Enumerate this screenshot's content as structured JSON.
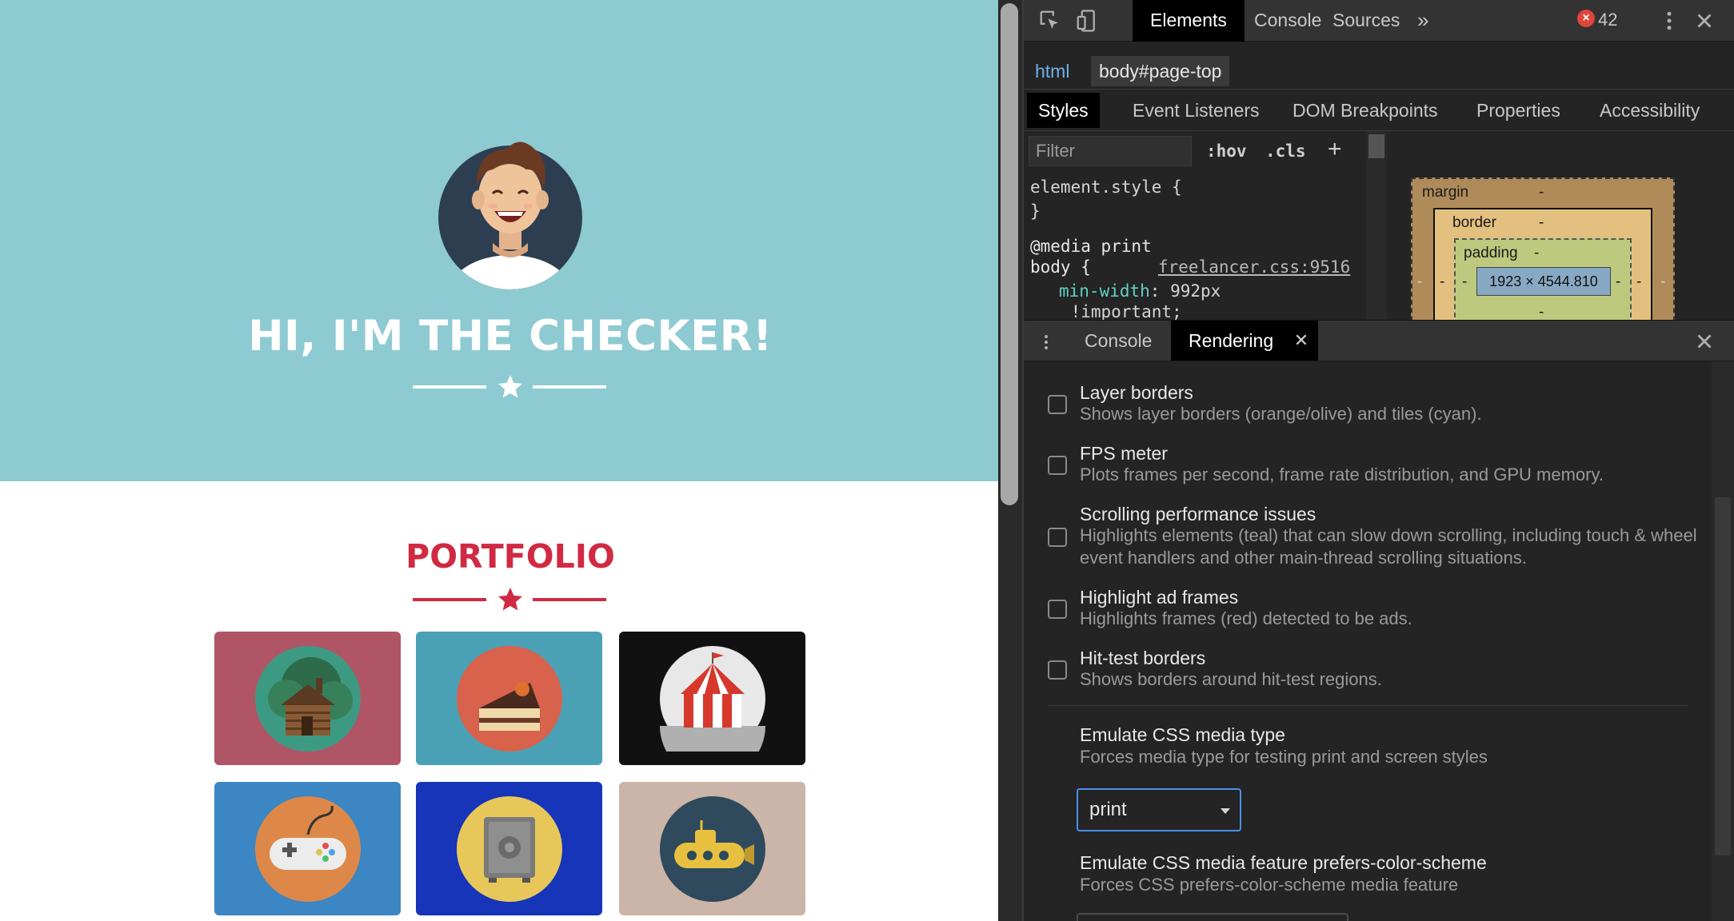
{
  "page": {
    "hero_title": "HI, I'M THE CHECKER!",
    "portfolio_title": "PORTFOLIO",
    "colors": {
      "hero_bg": "#8ecad2",
      "accent": "#d02a42"
    },
    "tiles": [
      {
        "name": "cabin",
        "bg": "#b05565",
        "disk": "#3d9a82"
      },
      {
        "name": "cake",
        "bg": "#4aa1b5",
        "disk": "#d8624c"
      },
      {
        "name": "circus-tent",
        "bg": "#111111",
        "disk": "#e8e8e8"
      },
      {
        "name": "game-controller",
        "bg": "#3c86c3",
        "disk": "#dd8848"
      },
      {
        "name": "safe",
        "bg": "#1635b8",
        "disk": "#e8c75a"
      },
      {
        "name": "submarine",
        "bg": "#cbb4a8",
        "disk": "#2e4a5c"
      }
    ]
  },
  "devtools": {
    "tabs": [
      "Elements",
      "Console",
      "Sources"
    ],
    "more_tabs": "»",
    "error_count": "42",
    "breadcrumb": [
      "html",
      "body#page-top"
    ],
    "subtabs": [
      "Styles",
      "Event Listeners",
      "DOM Breakpoints",
      "Properties",
      "Accessibility"
    ],
    "filter_placeholder": "Filter",
    "hov": ":hov",
    "cls": ".cls",
    "plus": "+",
    "code": {
      "line1": "element.style {",
      "line2": "}",
      "line3": "@media print",
      "line4": "body {",
      "source": "freelancer.css:9516",
      "prop_name": "min-width",
      "prop_value": ": 992px",
      "important": "    !important;"
    },
    "box_model": {
      "margin": "margin",
      "border": "border",
      "padding": "padding",
      "dash": "-",
      "content": "1923 × 4544.810"
    },
    "drawer_tabs": [
      "Console",
      "Rendering"
    ],
    "rendering": {
      "options": [
        {
          "title": "Layer borders",
          "desc": "Shows layer borders (orange/olive) and tiles (cyan)."
        },
        {
          "title": "FPS meter",
          "desc": "Plots frames per second, frame rate distribution, and GPU memory."
        },
        {
          "title": "Scrolling performance issues",
          "desc": "Highlights elements (teal) that can slow down scrolling, including touch & wheel event handlers and other main-thread scrolling situations."
        },
        {
          "title": "Highlight ad frames",
          "desc": "Highlights frames (red) detected to be ads."
        },
        {
          "title": "Hit-test borders",
          "desc": "Shows borders around hit-test regions."
        }
      ],
      "emulate_media_title": "Emulate CSS media type",
      "emulate_media_desc": "Forces media type for testing print and screen styles",
      "emulate_media_value": "print",
      "emulate_scheme_title": "Emulate CSS media feature prefers-color-scheme",
      "emulate_scheme_desc": "Forces CSS prefers-color-scheme media feature"
    }
  }
}
